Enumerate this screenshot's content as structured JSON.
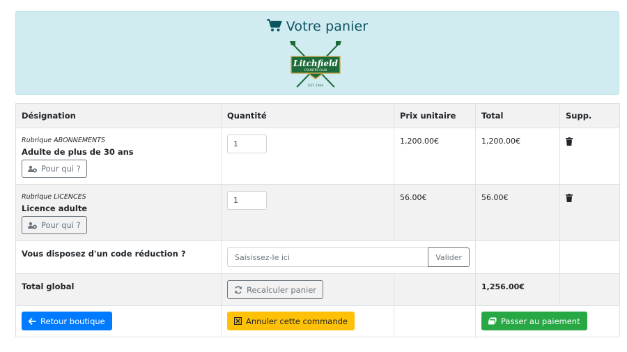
{
  "header": {
    "title": "Votre panier",
    "logo": {
      "name": "Litchfield",
      "subtitle": "COUNTRY CLUB",
      "est": "EST. 1964"
    }
  },
  "table": {
    "columns": [
      "Désignation",
      "Quantité",
      "Prix unitaire",
      "Total",
      "Supp."
    ],
    "items": [
      {
        "rubrique": "Rubrique ABONNEMENTS",
        "name": "Adulte de plus de 30 ans",
        "who_label": "Pour qui ?",
        "quantity": "1",
        "unit_price": "1,200.00€",
        "total": "1,200.00€"
      },
      {
        "rubrique": "Rubrique LICENCES",
        "name": "Licence adulte",
        "who_label": "Pour qui ?",
        "quantity": "1",
        "unit_price": "56.00€",
        "total": "56.00€"
      }
    ],
    "promo": {
      "label": "Vous disposez d'un code réduction ?",
      "placeholder": "Saisissez-le ici",
      "button": "Valider"
    },
    "summary": {
      "label": "Total global",
      "recalc_button": "Recalculer panier",
      "total": "1,256.00€"
    },
    "actions": {
      "back": "Retour boutique",
      "cancel": "Annuler cette commande",
      "pay": "Passer au paiement"
    }
  },
  "colors": {
    "header_bg": "#d1ecf1",
    "header_text": "#0c5460",
    "primary": "#007bff",
    "warning": "#ffc107",
    "success": "#28a745",
    "logo_green": "#1e6b3a"
  }
}
